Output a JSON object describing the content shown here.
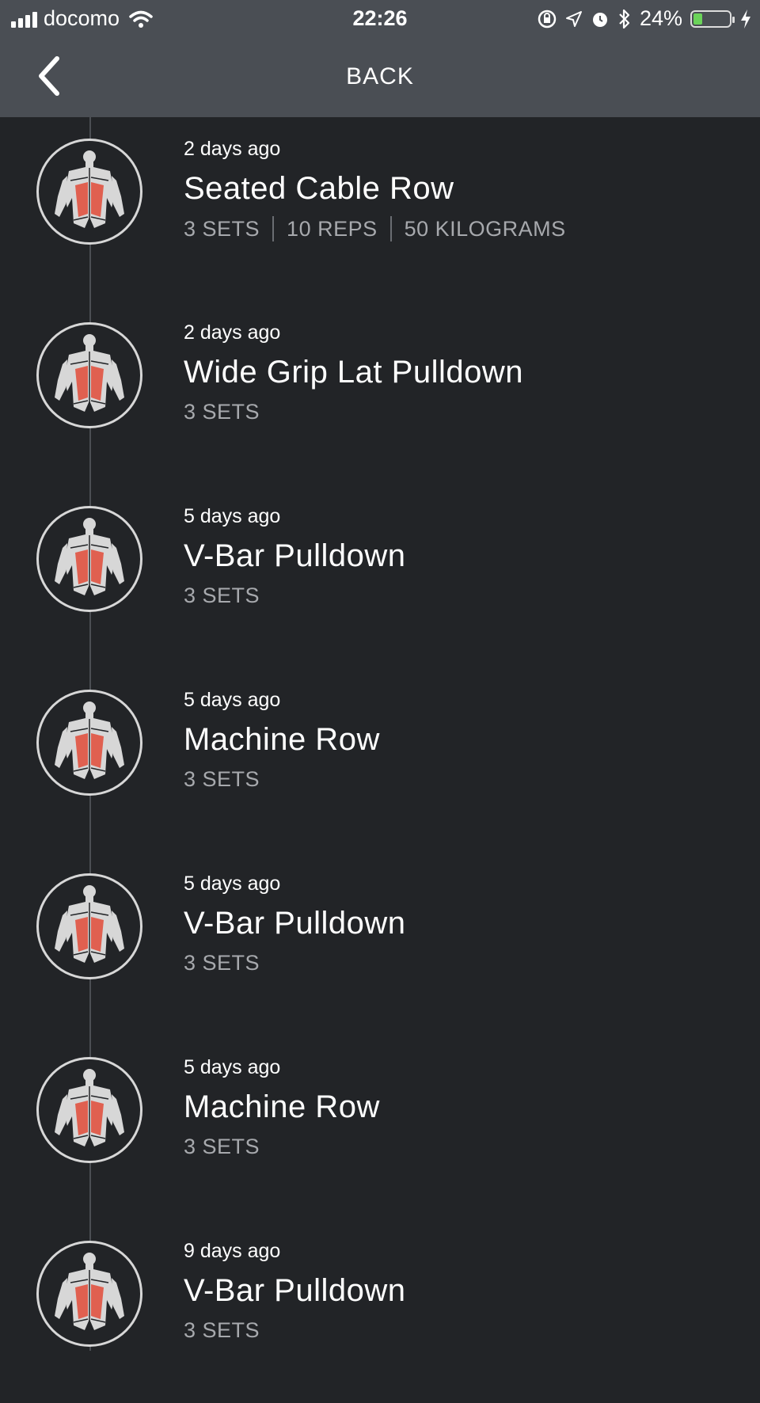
{
  "status_bar": {
    "carrier": "docomo",
    "time": "22:26",
    "battery": "24%",
    "battery_level": 0.24,
    "icons": [
      "signal-icon",
      "wifi-icon",
      "orientation-lock-icon",
      "location-icon",
      "alarm-icon",
      "bluetooth-icon",
      "battery-icon",
      "charging-icon"
    ]
  },
  "nav": {
    "title": "BACK",
    "back_icon": "chevron-left-icon"
  },
  "colors": {
    "background": "#222427",
    "header": "#4a4e54",
    "muscle_highlight": "#e06050",
    "timeline": "#4b4e53"
  },
  "workouts": [
    {
      "ago": "2 days ago",
      "name": "Seated Cable Row",
      "details": [
        "3 SETS",
        "10 REPS",
        "50 KILOGRAMS"
      ],
      "icon": "back-muscles-icon"
    },
    {
      "ago": "2 days ago",
      "name": "Wide Grip Lat Pulldown",
      "details": [
        "3 SETS"
      ],
      "icon": "back-muscles-icon"
    },
    {
      "ago": "5 days ago",
      "name": "V-Bar Pulldown",
      "details": [
        "3 SETS"
      ],
      "icon": "back-muscles-icon"
    },
    {
      "ago": "5 days ago",
      "name": "Machine Row",
      "details": [
        "3 SETS"
      ],
      "icon": "back-muscles-icon"
    },
    {
      "ago": "5 days ago",
      "name": "V-Bar Pulldown",
      "details": [
        "3 SETS"
      ],
      "icon": "back-muscles-icon"
    },
    {
      "ago": "5 days ago",
      "name": "Machine Row",
      "details": [
        "3 SETS"
      ],
      "icon": "back-muscles-icon"
    },
    {
      "ago": "9 days ago",
      "name": "V-Bar Pulldown",
      "details": [
        "3 SETS"
      ],
      "icon": "back-muscles-icon"
    }
  ]
}
